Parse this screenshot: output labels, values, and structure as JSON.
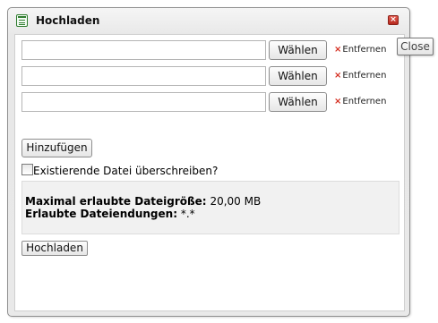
{
  "dialog": {
    "title": "Hochladen",
    "close_glyph": "×"
  },
  "file_rows": [
    {
      "value": "",
      "choose_label": "Wählen",
      "remove_label": "Entfernen"
    },
    {
      "value": "",
      "choose_label": "Wählen",
      "remove_label": "Entfernen"
    },
    {
      "value": "",
      "choose_label": "Wählen",
      "remove_label": "Entfernen"
    }
  ],
  "remove_glyph": "×",
  "add_label": "Hinzufügen",
  "overwrite": {
    "label": "Existierende Datei überschreiben?",
    "checked": false
  },
  "info": {
    "max_size_label": "Maximal erlaubte Dateigröße:",
    "max_size_value": "20,00 MB",
    "extensions_label": "Erlaubte Dateiendungen:",
    "extensions_value": "*.*"
  },
  "upload_label": "Hochladen",
  "tooltip": "Close",
  "icons": {
    "title": "form-icon",
    "close": "close-icon",
    "remove": "remove-x-icon",
    "checkbox": "checkbox"
  },
  "colors": {
    "close_button": "#d0392c",
    "remove_x": "#d42a1c",
    "icon_green": "#2f7d2f"
  }
}
